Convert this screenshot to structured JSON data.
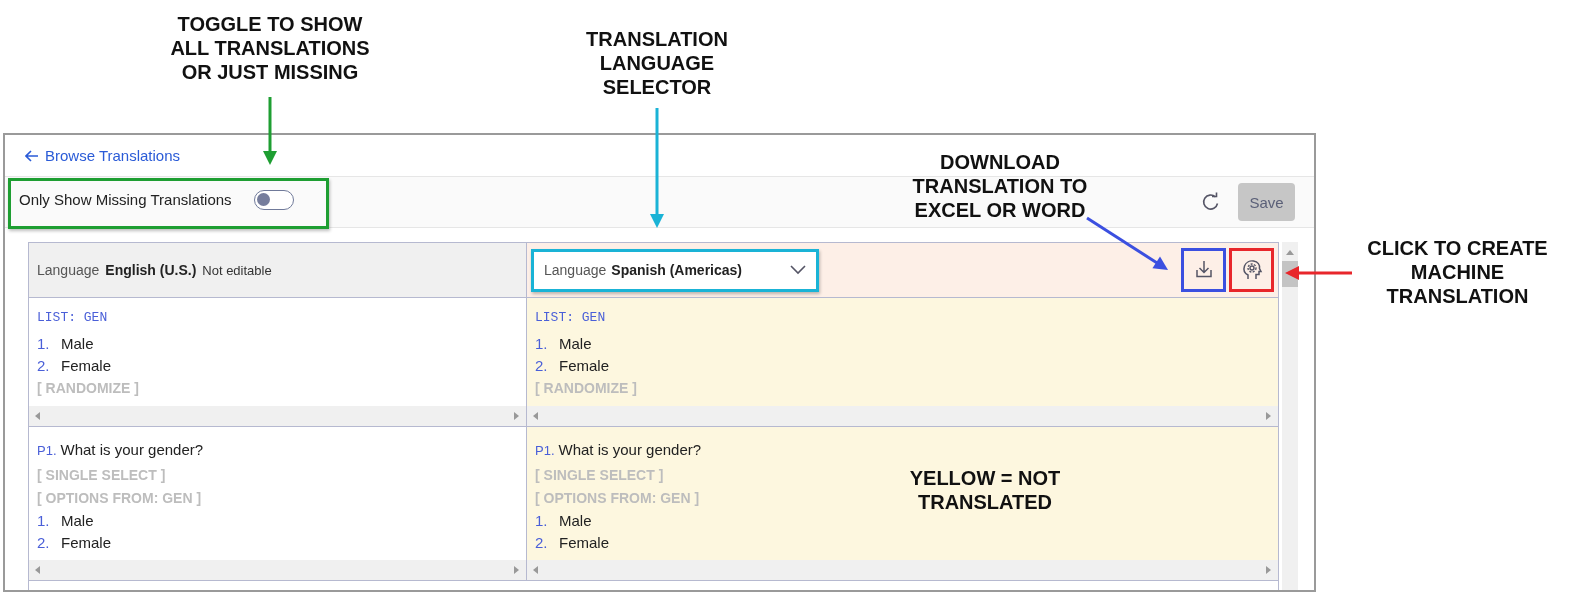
{
  "back_link": {
    "label": "Browse Translations"
  },
  "toolbar": {
    "toggle": {
      "label": "Only Show Missing Translations",
      "on": false,
      "color": "#1e9e32"
    },
    "save_button": {
      "label": "Save",
      "disabled": true
    }
  },
  "table": {
    "source_header": {
      "prefix": "Language",
      "language": "English (U.S.)",
      "note": "Not editable"
    },
    "target_header": {
      "prefix": "Language",
      "language": "Spanish (Americas)",
      "color": "#1ab3d6"
    },
    "actions": [
      {
        "kind": "download",
        "color": "#3b4fe0"
      },
      {
        "kind": "machine_translate",
        "color": "#e8262b"
      }
    ],
    "rows": [
      {
        "source": {
          "lines": [
            {
              "kind": "list_label",
              "text": "LIST: GEN"
            },
            {
              "kind": "option",
              "number": "1.",
              "text": "Male"
            },
            {
              "kind": "option",
              "number": "2.",
              "text": "Female"
            },
            {
              "kind": "tag",
              "text": "[ RANDOMIZE ]"
            }
          ]
        },
        "target": {
          "translated": false,
          "lines": [
            {
              "kind": "list_label",
              "text": "LIST: GEN"
            },
            {
              "kind": "option",
              "number": "1.",
              "text": "Male"
            },
            {
              "kind": "option",
              "number": "2.",
              "text": "Female"
            },
            {
              "kind": "tag",
              "text": "[ RANDOMIZE ]"
            }
          ]
        }
      },
      {
        "source": {
          "lines": [
            {
              "kind": "question",
              "number": "P1.",
              "text": "What is your gender?"
            },
            {
              "kind": "tag",
              "text": "[ SINGLE SELECT ]"
            },
            {
              "kind": "tag",
              "text": "[ OPTIONS FROM: GEN ]"
            },
            {
              "kind": "option",
              "number": "1.",
              "text": "Male"
            },
            {
              "kind": "option",
              "number": "2.",
              "text": "Female"
            }
          ]
        },
        "target": {
          "translated": false,
          "lines": [
            {
              "kind": "question",
              "number": "P1.",
              "text": "What is your gender?"
            },
            {
              "kind": "tag",
              "text": "[ SINGLE SELECT ]"
            },
            {
              "kind": "tag",
              "text": "[ OPTIONS FROM: GEN ]"
            },
            {
              "kind": "option",
              "number": "1.",
              "text": "Male"
            },
            {
              "kind": "option",
              "number": "2.",
              "text": "Female"
            }
          ]
        }
      }
    ]
  },
  "annotations": [
    {
      "lines": [
        "TOGGLE TO SHOW",
        "ALL TRANSLATIONS",
        "OR JUST MISSING"
      ],
      "color": "#1e9e32"
    },
    {
      "lines": [
        "TRANSLATION",
        "LANGUAGE",
        "SELECTOR"
      ],
      "color": "#1ab3d6"
    },
    {
      "lines": [
        "DOWNLOAD",
        "TRANSLATION TO",
        "EXCEL OR WORD"
      ],
      "color": "#3b4fe0"
    },
    {
      "lines": [
        "CLICK TO CREATE",
        "MACHINE",
        "TRANSLATION"
      ],
      "color": "#e8262b"
    },
    {
      "lines": [
        "YELLOW = NOT",
        "TRANSLATED"
      ]
    }
  ]
}
